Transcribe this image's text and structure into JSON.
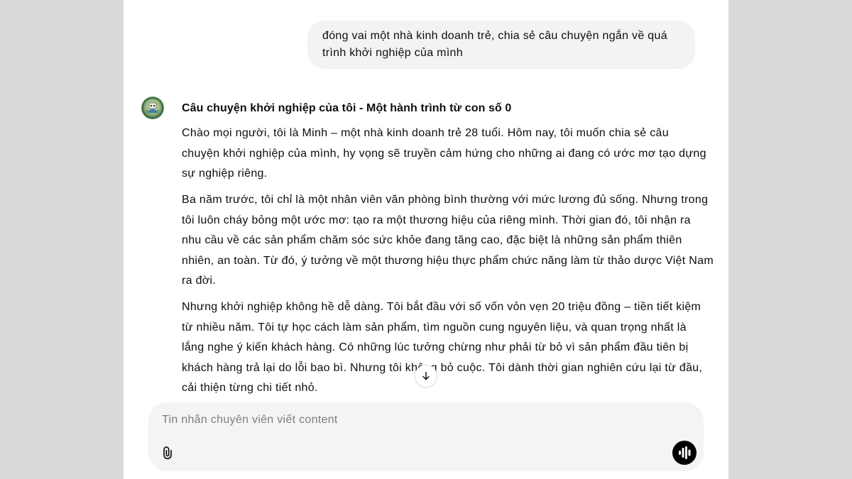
{
  "colors": {
    "page_bg": "#d9d9d9",
    "panel_bg": "#ffffff",
    "bubble_bg": "#f3f3f3",
    "composer_bg": "#f4f4f4",
    "text": "#0d0d0d",
    "placeholder": "#7d7d7d",
    "voice_button_bg": "#000000"
  },
  "conversation": {
    "user_message": {
      "lines": [
        "đóng vai một nhà kinh doanh trẻ, chia sẻ câu chuyện ngắn về quá",
        "trình khởi nghiệp của mình"
      ]
    },
    "assistant_message": {
      "avatar_icon": "gpt-avatar-icon",
      "heading": "Câu chuyện khởi nghiệp của tôi - Một hành trình từ con số 0",
      "paragraphs": [
        {
          "lines": [
            "Chào mọi người, tôi là Minh – một nhà kinh doanh trẻ 28 tuổi. Hôm nay, tôi muốn chia sẻ câu",
            "chuyện khởi nghiệp của mình, hy vọng sẽ truyền cảm hứng cho những ai đang có ước mơ tạo dựng",
            "sự nghiệp riêng."
          ]
        },
        {
          "lines": [
            "Ba năm trước, tôi chỉ là một nhân viên văn phòng bình thường với mức lương đủ sống. Nhưng trong",
            "tôi luôn cháy bỏng một ước mơ: tạo ra một thương hiệu của riêng mình. Thời gian đó, tôi nhận ra",
            "nhu cầu về các sản phẩm chăm sóc sức khỏe đang tăng cao, đặc biệt là những sản phẩm thiên",
            "nhiên, an toàn. Từ đó, ý tưởng về một thương hiệu thực phẩm chức năng làm từ thảo dược Việt Nam",
            "ra đời."
          ]
        },
        {
          "lines": [
            "Nhưng khởi nghiệp không hề dễ dàng. Tôi bắt đầu với số vốn vỏn vẹn 20 triệu đồng – tiền tiết kiệm",
            "từ nhiều năm. Tôi tự học cách làm sản phẩm, tìm nguồn cung nguyên liệu, và quan trọng nhất là",
            "lắng nghe ý kiến khách hàng. Có những lúc tưởng chừng như phải từ bỏ vì sản phẩm đầu tiên bị",
            "khách hàng trả lại do lỗi bao bì. Nhưng tôi không bỏ cuộc. Tôi dành thời gian nghiên cứu lại từ đầu,",
            "cải thiện từng chi tiết nhỏ."
          ]
        }
      ]
    }
  },
  "scroll_to_bottom": {
    "icon": "arrow-down-icon"
  },
  "composer": {
    "placeholder": "Tin nhắn chuyên viên viết content",
    "attach_icon": "paperclip-icon",
    "voice_icon": "voice-waveform-icon"
  }
}
